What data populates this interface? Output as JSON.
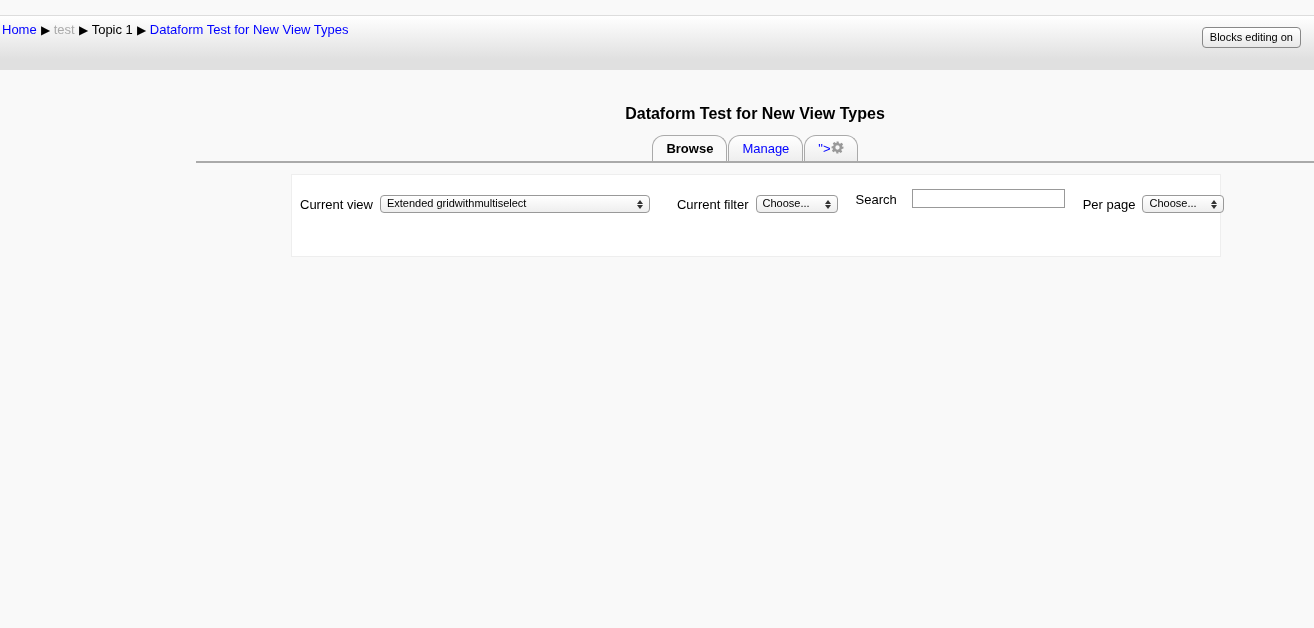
{
  "breadcrumb": [
    {
      "label": "Home",
      "kind": "link"
    },
    {
      "label": "test",
      "kind": "dimmed"
    },
    {
      "label": "Topic 1",
      "kind": "text"
    },
    {
      "label": "Dataform Test for New View Types",
      "kind": "link"
    }
  ],
  "separator": "▶",
  "header_button": "Blocks editing on",
  "title": "Dataform Test for New View Types",
  "tabs": [
    {
      "label": "Browse",
      "selected": true,
      "gear": false
    },
    {
      "label": "Manage",
      "selected": false,
      "gear": false
    },
    {
      "label": "\">",
      "selected": false,
      "gear": true
    }
  ],
  "filters": {
    "current_view": {
      "label": "Current view",
      "value": "Extended gridwithmultiselect"
    },
    "current_filter": {
      "label": "Current filter",
      "value": "Choose..."
    },
    "search": {
      "label": "Search"
    },
    "per_page": {
      "label": "Per page",
      "value": "Choose..."
    }
  }
}
